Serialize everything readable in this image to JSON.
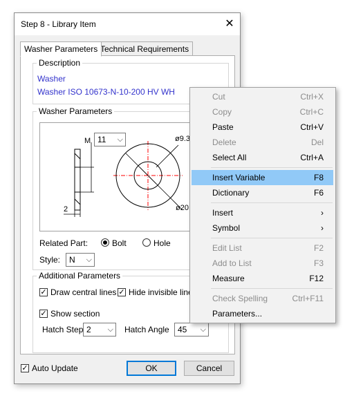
{
  "dialog": {
    "title": "Step 8 - Library Item",
    "close_glyph": "✕",
    "tabs": [
      "Washer Parameters",
      "Technical Requirements"
    ],
    "description": {
      "label": "Description",
      "lines": [
        "Washer",
        "Washer ISO 10673-N-10-200 HV WH"
      ]
    },
    "washer_params": {
      "label": "Washer Parameters",
      "m_label": "M",
      "m_value": "11",
      "dim_d1": "ø9.3",
      "dim_d2": "ø20",
      "dim_thickness": "2",
      "related_part_label": "Related Part:",
      "related_options": [
        "Bolt",
        "Hole"
      ],
      "related_selected": "Bolt",
      "style_label": "Style:",
      "style_value": "N"
    },
    "additional": {
      "label": "Additional Parameters",
      "draw_central_lines": {
        "label": "Draw central lines",
        "checked": true
      },
      "hide_invisible_lines": {
        "label": "Hide invisible lines",
        "checked": true
      },
      "show_section": {
        "label": "Show section",
        "checked": true
      },
      "hatch_step_label": "Hatch Step",
      "hatch_step_value": "2",
      "hatch_angle_label": "Hatch Angle",
      "hatch_angle_value": "45"
    },
    "footer": {
      "auto_update": {
        "label": "Auto Update",
        "checked": true
      },
      "ok_label": "OK",
      "cancel_label": "Cancel"
    }
  },
  "context_menu": {
    "items": [
      {
        "label": "Cut",
        "shortcut": "Ctrl+X",
        "disabled": true
      },
      {
        "label": "Copy",
        "shortcut": "Ctrl+C",
        "disabled": true
      },
      {
        "label": "Paste",
        "shortcut": "Ctrl+V",
        "disabled": false
      },
      {
        "label": "Delete",
        "shortcut": "Del",
        "disabled": true
      },
      {
        "label": "Select All",
        "shortcut": "Ctrl+A",
        "disabled": false
      },
      {
        "label": "Insert Variable",
        "shortcut": "F8",
        "disabled": false,
        "highlighted": true
      },
      {
        "label": "Dictionary",
        "shortcut": "F6",
        "disabled": false
      },
      {
        "label": "Insert",
        "shortcut": "›",
        "disabled": false
      },
      {
        "label": "Symbol",
        "shortcut": "›",
        "disabled": false
      },
      {
        "label": "Edit List",
        "shortcut": "F2",
        "disabled": true
      },
      {
        "label": "Add to List",
        "shortcut": "F3",
        "disabled": true
      },
      {
        "label": "Measure",
        "shortcut": "F12",
        "disabled": false
      },
      {
        "label": "Check Spelling",
        "shortcut": "Ctrl+F11",
        "disabled": true
      },
      {
        "label": "Parameters...",
        "shortcut": "",
        "disabled": false
      }
    ]
  },
  "colors": {
    "accent": "#0078d7",
    "menu_highlight": "#91c9f7",
    "description_text": "#3333cc",
    "drawing_centerline": "#ff0000"
  }
}
